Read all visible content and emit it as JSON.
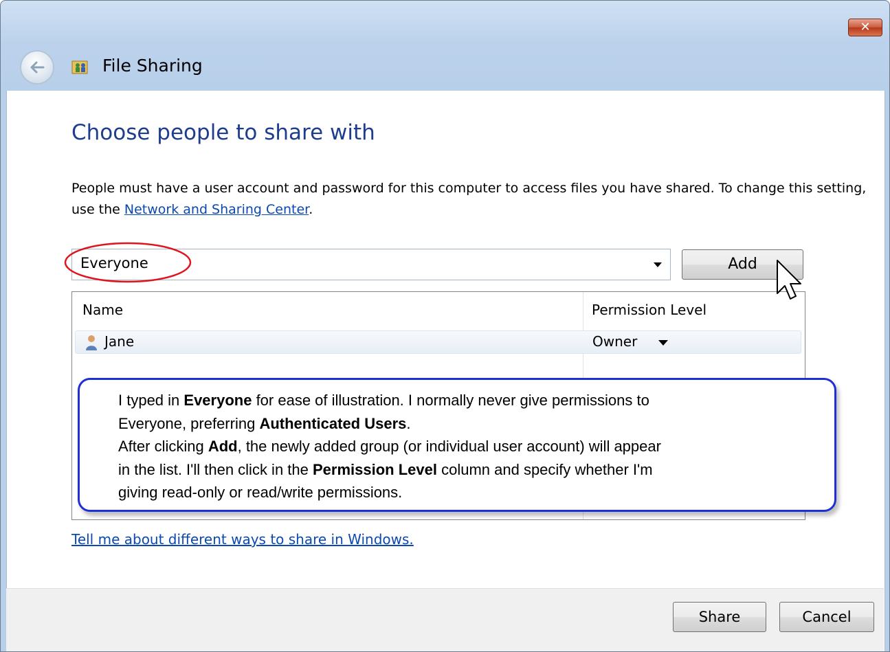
{
  "window": {
    "title": "File Sharing",
    "close_label": "✕"
  },
  "main": {
    "heading": "Choose people to share with",
    "description_before_link": "People must have a user account and password for this computer to access files you have shared.  To change this setting, use the ",
    "description_link": "Network and Sharing Center",
    "description_after_link": "."
  },
  "picker": {
    "value": "Everyone",
    "add_label": "Add"
  },
  "list": {
    "columns": [
      "Name",
      "Permission Level"
    ],
    "rows": [
      {
        "name": "Jane",
        "permission": "Owner"
      }
    ]
  },
  "callout": {
    "lines": [
      [
        "I typed in ",
        "Everyone",
        " for ease of illustration.  I normally never give permissions to"
      ],
      [
        "Everyone, preferring ",
        "Authenticated Users",
        "."
      ],
      [
        "After clicking ",
        "Add",
        ", the newly added group (or individual user account) will appear"
      ],
      [
        "in the list.  I'll then click in the ",
        "Permission Level",
        " column and specify whether I'm"
      ],
      [
        "giving read-only or read/write permissions."
      ]
    ],
    "border_color": "#1f2fd6"
  },
  "help_link": "Tell me about different ways to share in Windows.",
  "footer": {
    "share_label": "Share",
    "cancel_label": "Cancel"
  },
  "colors": {
    "heading": "#1e3d8f",
    "link": "#0a48b4",
    "highlight_ellipse": "#e0141e"
  },
  "icons": [
    "back-arrow-icon",
    "file-sharing-icon",
    "user-icon",
    "dropdown-arrow-icon",
    "mouse-pointer-icon"
  ]
}
